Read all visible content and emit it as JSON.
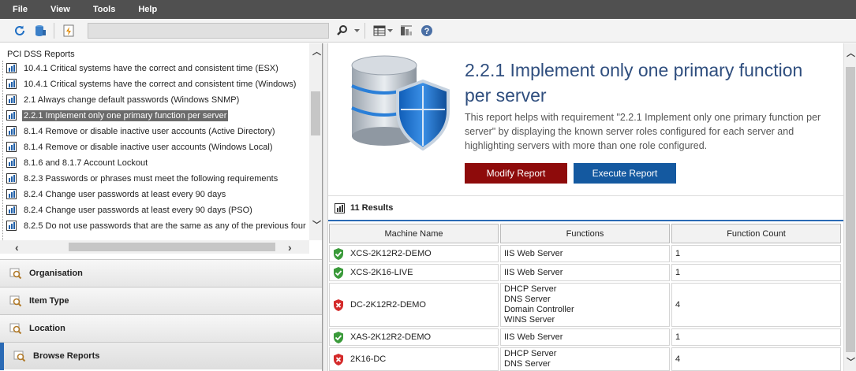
{
  "menu": [
    "File",
    "View",
    "Tools",
    "Help"
  ],
  "toolbar": {
    "search_value": "",
    "icons": [
      "refresh-icon",
      "database-icon",
      "flash-report-icon",
      "search-icon",
      "columns-icon",
      "filter-icon",
      "help-icon"
    ]
  },
  "tree": {
    "title": "PCI DSS Reports",
    "items": [
      "10.4.1 Critical systems have the correct and consistent time (ESX)",
      "10.4.1 Critical systems have the correct and consistent time (Windows)",
      "2.1 Always change default passwords (Windows SNMP)",
      "2.2.1 Implement only one primary function per server",
      "8.1.4 Remove or disable inactive user accounts (Active Directory)",
      "8.1.4 Remove or disable inactive user accounts (Windows Local)",
      "8.1.6 and 8.1.7 Account Lockout",
      "8.2.3 Passwords or phrases must meet the following requirements",
      "8.2.4 Change user passwords at least every 90 days",
      "8.2.4 Change user passwords at least every 90 days (PSO)",
      "8.2.5 Do not use passwords that are the same as any of the previous four"
    ],
    "selected_index": 3
  },
  "accordion": [
    {
      "label": "Organisation",
      "icon": "organisation-search-icon"
    },
    {
      "label": "Item Type",
      "icon": "item-type-search-icon"
    },
    {
      "label": "Location",
      "icon": "location-search-icon"
    },
    {
      "label": "Browse Reports",
      "icon": "browse-reports-icon"
    }
  ],
  "report": {
    "title": "2.2.1 Implement only one primary function per server",
    "description": "This report helps with requirement \"2.2.1 Implement only one primary function per server\" by displaying the known server roles configured for each server and highlighting servers with more than one role configured.",
    "modify_label": "Modify Report",
    "execute_label": "Execute Report"
  },
  "results": {
    "count_label": "11 Results",
    "columns": [
      "Machine Name",
      "Functions",
      "Function Count"
    ],
    "rows": [
      {
        "machine": "XCS-2K12R2-DEMO",
        "status": "ok",
        "functions": [
          "IIS Web Server"
        ],
        "count": "1"
      },
      {
        "machine": "XCS-2K16-LIVE",
        "status": "ok",
        "functions": [
          "IIS Web Server"
        ],
        "count": "1"
      },
      {
        "machine": "DC-2K12R2-DEMO",
        "status": "error",
        "functions": [
          "DHCP Server",
          "DNS Server",
          "Domain Controller",
          "WINS Server"
        ],
        "count": "4"
      },
      {
        "machine": "XAS-2K12R2-DEMO",
        "status": "ok",
        "functions": [
          "IIS Web Server"
        ],
        "count": "1"
      },
      {
        "machine": "2K16-DC",
        "status": "error",
        "functions": [
          "DHCP Server",
          "DNS Server"
        ],
        "count": "4"
      }
    ]
  },
  "colors": {
    "menubar": "#505050",
    "title": "#2f4e7e",
    "modify": "#8e0b0b",
    "execute": "#1459a0",
    "ok": "#3a9a3a",
    "error": "#d42a2a"
  }
}
